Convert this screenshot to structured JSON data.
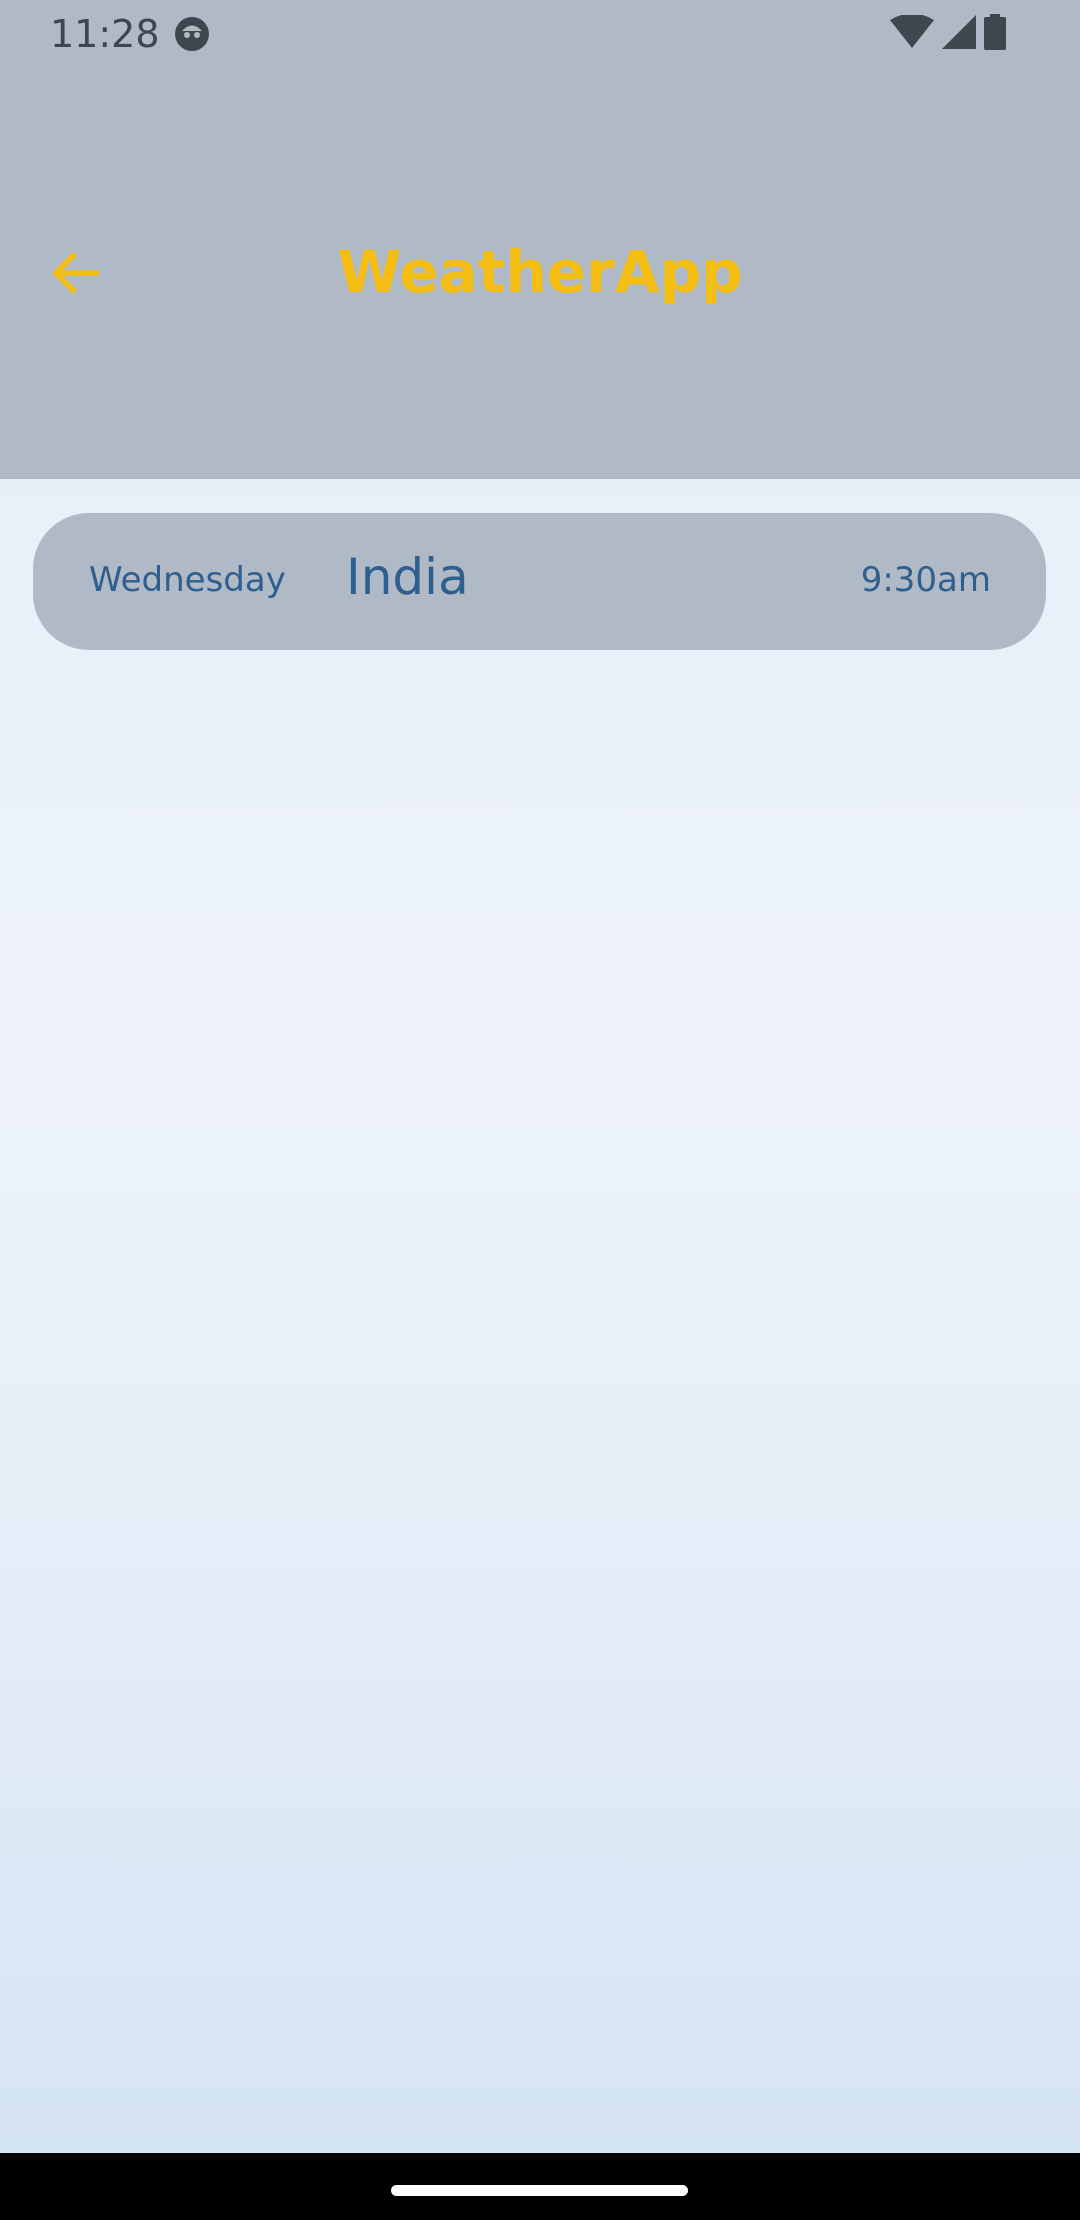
{
  "status_bar": {
    "time": "11:28",
    "icons": [
      "face-icon",
      "wifi-icon",
      "signal-icon",
      "battery-icon"
    ]
  },
  "app_bar": {
    "title": "WeatherApp",
    "back_icon": "arrow-back-icon"
  },
  "cities": [
    {
      "day": "Wednesday",
      "city": "India",
      "time": "9:30am"
    }
  ],
  "colors": {
    "header_bg": "#b0bac6",
    "title": "#f5be12",
    "card_text": "#2e5f8f",
    "card_bg": "#b0bac6"
  }
}
